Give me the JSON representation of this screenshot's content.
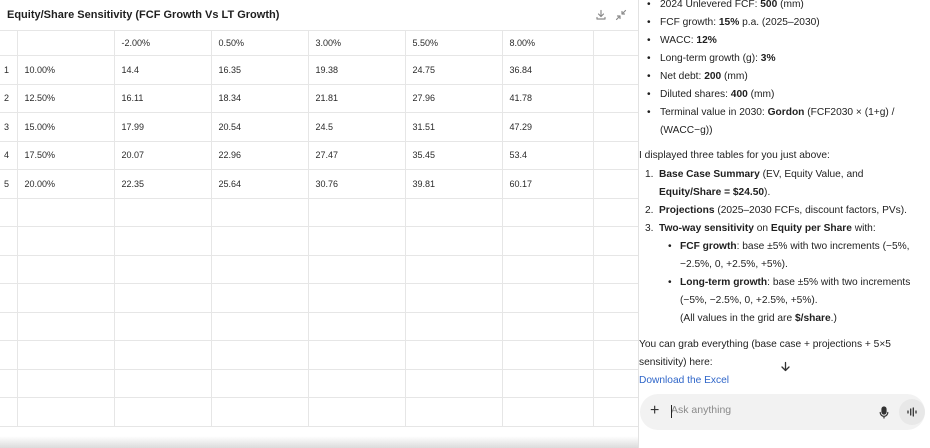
{
  "sheet": {
    "title": "Equity/Share Sensitivity (FCF Growth Vs LT Growth)",
    "header_row": [
      "",
      "",
      "-2.00%",
      "0.50%",
      "3.00%",
      "5.50%",
      "8.00%",
      ""
    ],
    "rows": [
      [
        "1",
        "10.00%",
        "14.4",
        "16.35",
        "19.38",
        "24.75",
        "36.84",
        ""
      ],
      [
        "2",
        "12.50%",
        "16.11",
        "18.34",
        "21.81",
        "27.96",
        "41.78",
        ""
      ],
      [
        "3",
        "15.00%",
        "17.99",
        "20.54",
        "24.5",
        "31.51",
        "47.29",
        ""
      ],
      [
        "4",
        "17.50%",
        "20.07",
        "22.96",
        "27.47",
        "35.45",
        "53.4",
        ""
      ],
      [
        "5",
        "20.00%",
        "22.35",
        "25.64",
        "30.76",
        "39.81",
        "60.17",
        ""
      ]
    ],
    "icons": {
      "download": "download-icon",
      "collapse": "collapse-icon"
    }
  },
  "chat": {
    "bullets": [
      {
        "pre": "2024 Unlevered FCF: ",
        "bold": "500",
        "post": " (mm)"
      },
      {
        "pre": "FCF growth: ",
        "bold": "15%",
        "post": " p.a. (2025–2030)"
      },
      {
        "pre": "WACC: ",
        "bold": "12%",
        "post": ""
      },
      {
        "pre": "Long-term growth (g): ",
        "bold": "3%",
        "post": ""
      },
      {
        "pre": "Net debt: ",
        "bold": "200",
        "post": " (mm)"
      },
      {
        "pre": "Diluted shares: ",
        "bold": "400",
        "post": " (mm)"
      }
    ],
    "terminal": {
      "pre": "Terminal value in 2030: ",
      "bold": "Gordon",
      "post": " (FCF2030 × (1+g) /",
      "line2": "(WACC−g))"
    },
    "intro": "I displayed three tables for you just above:",
    "list": [
      {
        "num": "1.",
        "bold": "Base Case Summary",
        "post": " (EV, Equity Value, and",
        "line2_bold": "Equity/Share = $24.50",
        "line2_post": ")."
      },
      {
        "num": "2.",
        "bold": "Projections",
        "post": " (2025–2030 FCFs, discount factors, PVs)."
      },
      {
        "num": "3.",
        "bold": "Two-way sensitivity",
        "post": " on ",
        "bold2": "Equity per Share",
        "post2": " with:"
      }
    ],
    "sub": [
      {
        "bold": "FCF growth",
        "post": ": base ±5% with two increments (−5%,",
        "line2": "−2.5%, 0, +2.5%, +5%)."
      },
      {
        "bold": "Long-term growth",
        "post": ": base ±5% with two increments",
        "line2": "(−5%, −2.5%, 0, +2.5%, +5%)."
      }
    ],
    "note": {
      "pre": "(All values in the grid are ",
      "bold": "$/share",
      "post": ".)"
    },
    "grab_line1": "You can grab everything (base case + projections + 5×5",
    "grab_line2": "sensitivity) here:",
    "link": "Download the Excel",
    "scroll_icon": "arrow-down-icon"
  },
  "composer": {
    "placeholder": "Ask anything",
    "plus_icon": "plus-icon",
    "mic_icon": "microphone-icon",
    "voice_icon": "voice-mode-icon"
  }
}
